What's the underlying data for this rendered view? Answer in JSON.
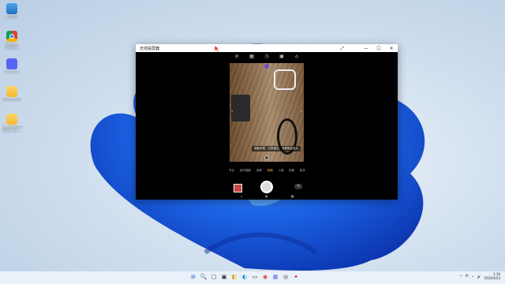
{
  "desktop": {
    "icons": [
      {
        "label": "此电脑",
        "icon": "pc-icon"
      },
      {
        "label": "Google\nChrome",
        "icon": "chrome-icon"
      },
      {
        "label": "Discord",
        "icon": "discord-icon"
      },
      {
        "label": "新建文件夹",
        "icon": "folder-icon"
      },
      {
        "label": "ScreenShots\n2022-04-...",
        "icon": "folder-icon"
      }
    ]
  },
  "window": {
    "title": "无线投屏器",
    "controls": {
      "minimize": "—",
      "maximize": "☐",
      "close": "✕",
      "expand": "⤢"
    }
  },
  "phone": {
    "toolbar": [
      "⊘",
      "▦",
      "◷",
      "▣",
      "⌂"
    ],
    "hint": "轻触对焦，长按锁定，对焦框会变大",
    "modes": [
      "专业",
      "延时摄影",
      "录像",
      "拍照",
      "人像",
      "夜景",
      "更多"
    ],
    "active_mode": "拍照",
    "nav": [
      "◂",
      "●",
      "■"
    ]
  },
  "taskbar": {
    "center_icons": [
      "⊞",
      "🔍",
      "▢",
      "▣",
      "◧",
      "◐",
      "▭",
      "◉",
      "▦",
      "◎",
      "✦"
    ],
    "tray": [
      "^",
      "中",
      "⚡",
      "🔊"
    ],
    "time": "1:16",
    "date": "2022/4/23"
  }
}
